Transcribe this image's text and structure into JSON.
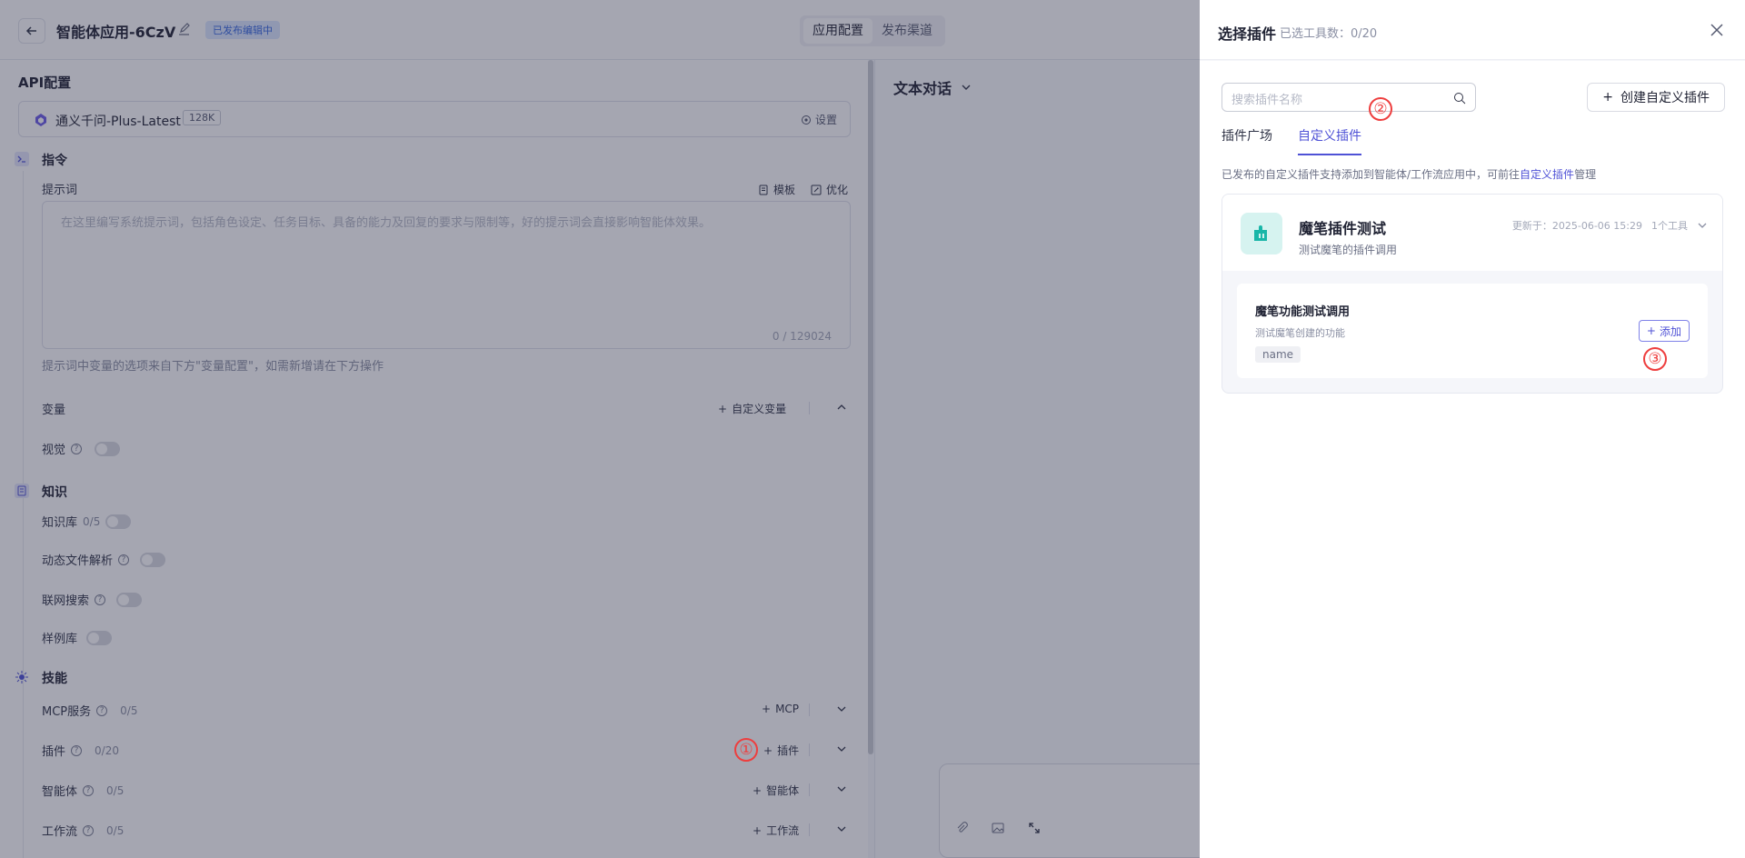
{
  "topbar": {
    "app_title": "智能体应用-6CzV",
    "status_badge": "已发布编辑中",
    "tabs": [
      "应用配置",
      "发布渠道"
    ]
  },
  "config": {
    "api_title": "API配置",
    "model": {
      "name": "通义千问-Plus-Latest",
      "context": "128K",
      "settings_label": "设置"
    },
    "instruction": {
      "title": "指令",
      "prompt_label": "提示词",
      "template_label": "模板",
      "optimize_label": "优化",
      "placeholder": "在这里编写系统提示词，包括角色设定、任务目标、具备的能力及回复的要求与限制等，好的提示词会直接影响智能体效果。",
      "count": "0 / 129024",
      "hint": "提示词中变量的选项来自下方\"变量配置\"，如需新增请在下方操作"
    },
    "variables": {
      "label": "变量",
      "add_label": "自定义变量"
    },
    "vision": {
      "label": "视觉"
    },
    "knowledge": {
      "title": "知识",
      "kb_label": "知识库",
      "kb_count": "0/5",
      "file_parse_label": "动态文件解析",
      "web_search_label": "联网搜索",
      "examples_label": "样例库"
    },
    "skills": {
      "title": "技能",
      "items": [
        {
          "label": "MCP服务",
          "count": "0/5",
          "action": "MCP"
        },
        {
          "label": "插件",
          "count": "0/20",
          "action": "插件"
        },
        {
          "label": "智能体",
          "count": "0/5",
          "action": "智能体"
        },
        {
          "label": "工作流",
          "count": "0/5",
          "action": "工作流"
        }
      ]
    }
  },
  "preview": {
    "title": "文本对话"
  },
  "drawer": {
    "title": "选择插件",
    "selected_count": "已选工具数：0/20",
    "search_placeholder": "搜索插件名称",
    "create_label": "创建自定义插件",
    "tabs": [
      "插件广场",
      "自定义插件"
    ],
    "active_tab": "自定义插件",
    "info_prefix": "已发布的自定义插件支持添加到智能体/工作流应用中，可前往",
    "info_link": "自定义插件",
    "info_suffix": "管理",
    "plugin": {
      "name": "魔笔插件测试",
      "desc": "测试魔笔的插件调用",
      "updated": "更新于：2025-06-06 15:29",
      "tool_count": "1个工具",
      "tool": {
        "name": "魔笔功能测试调用",
        "desc": "测试魔笔创建的功能",
        "param": "name",
        "add_label": "添加"
      }
    }
  },
  "markers": [
    "①",
    "②",
    "③"
  ],
  "colors": {
    "accent": "#4f52d6",
    "marker": "#ee3e3e",
    "badge_bg": "#dbe7ff",
    "plugin_logo": "#19b6a8"
  }
}
